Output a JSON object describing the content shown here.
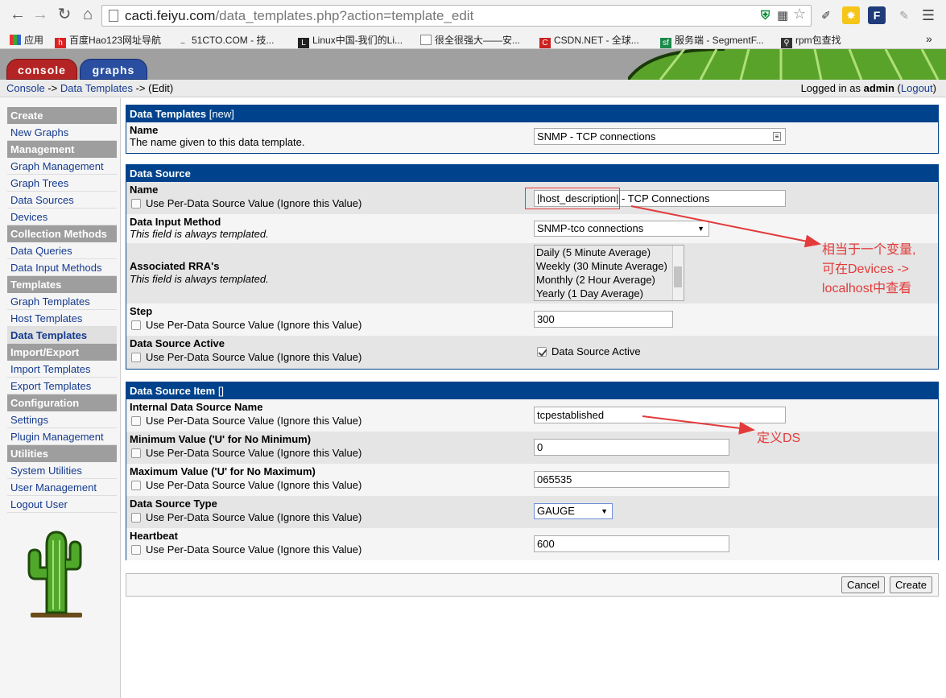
{
  "browser": {
    "url_host": "cacti.feiyu.com",
    "url_path": "/data_templates.php?action=template_edit",
    "bookmarks": [
      "应用",
      "百度Hao123网址导航",
      "51CTO.COM - 技...",
      "Linux中国-我们的Li...",
      "很全很强大——安...",
      "CSDN.NET - 全球...",
      "服务端 - SegmentF...",
      "rpm包查找"
    ]
  },
  "tabs": {
    "console": "console",
    "graphs": "graphs"
  },
  "breadcrumb": {
    "console": "Console",
    "sep1": " -> ",
    "templates": "Data Templates",
    "sep2": " -> ",
    "edit": "(Edit)"
  },
  "login": {
    "prefix": "Logged in as ",
    "user": "admin",
    "paren_open": " (",
    "logout": "Logout",
    "paren_close": ")"
  },
  "sidebar": {
    "create": "Create",
    "new_graphs": "New Graphs",
    "management": "Management",
    "graph_management": "Graph Management",
    "graph_trees": "Graph Trees",
    "data_sources": "Data Sources",
    "devices": "Devices",
    "collection": "Collection Methods",
    "data_queries": "Data Queries",
    "data_input_methods": "Data Input Methods",
    "templates": "Templates",
    "graph_templates": "Graph Templates",
    "host_templates": "Host Templates",
    "data_templates": "Data Templates",
    "import_export": "Import/Export",
    "import_templates": "Import Templates",
    "export_templates": "Export Templates",
    "configuration": "Configuration",
    "settings": "Settings",
    "plugin_management": "Plugin Management",
    "utilities": "Utilities",
    "system_utilities": "System Utilities",
    "user_management": "User Management",
    "logout_user": "Logout User"
  },
  "panel1": {
    "title": "Data Templates",
    "title_sub": " [new]",
    "name_label": "Name",
    "name_desc": "The name given to this data template.",
    "name_value": "SNMP - TCP connections"
  },
  "panel2": {
    "title": "Data Source",
    "per_ds": "Use Per-Data Source Value (Ignore this Value)",
    "name_label": "Name",
    "name_value": "|host_description| - TCP Connections",
    "input_label": "Data Input Method",
    "input_desc": "This field is always templated.",
    "input_value": "SNMP-tco connections",
    "rra_label": "Associated RRA's",
    "rra_desc": "This field is always templated.",
    "rra_options": [
      "Daily (5 Minute Average)",
      "Weekly (30 Minute Average)",
      "Monthly (2 Hour Average)",
      "Yearly (1 Day Average)"
    ],
    "step_label": "Step",
    "step_value": "300",
    "active_label": "Data Source Active",
    "active_value": "Data Source Active"
  },
  "panel3": {
    "title": "Data Source Item",
    "title_sub": " []",
    "per_ds": "Use Per-Data Source Value (Ignore this Value)",
    "ds_name_label": "Internal Data Source Name",
    "ds_name_value": "tcpestablished",
    "min_label": "Minimum Value ('U' for No Minimum)",
    "min_value": "0",
    "max_label": "Maximum Value ('U' for No Maximum)",
    "max_value": "065535",
    "type_label": "Data Source Type",
    "type_value": "GAUGE",
    "hb_label": "Heartbeat",
    "hb_value": "600"
  },
  "buttons": {
    "cancel": "Cancel",
    "create": "Create"
  },
  "annotations": {
    "var_line1": "相当于一个变量,",
    "var_line2": "可在Devices ->",
    "var_line3": "localhost中查看",
    "ds": "定义DS"
  },
  "colors": {
    "header_blue": "#00438c",
    "annotation_red": "#e23b3b",
    "console_tab": "#b52424",
    "graphs_tab": "#2a4fa0"
  }
}
